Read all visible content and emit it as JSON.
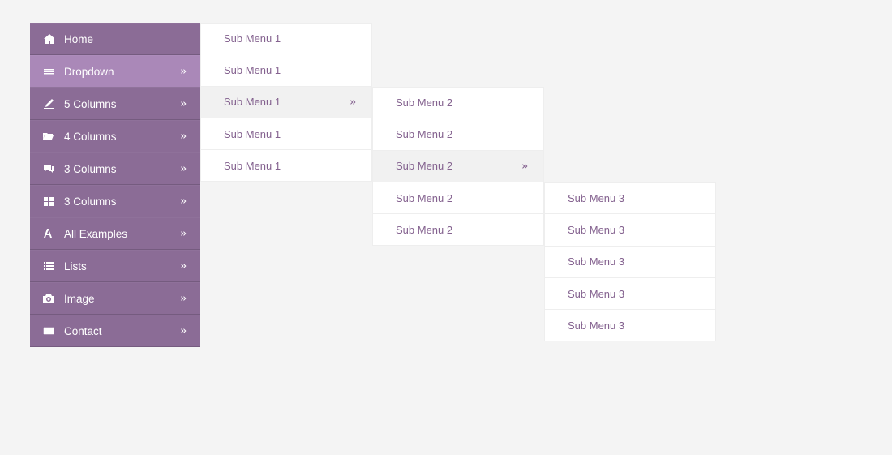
{
  "sidebar": {
    "items": [
      {
        "label": "Home",
        "icon": "home",
        "hasSubmenu": false,
        "active": false
      },
      {
        "label": "Dropdown",
        "icon": "layers",
        "hasSubmenu": true,
        "active": true
      },
      {
        "label": "5 Columns",
        "icon": "edit",
        "hasSubmenu": true,
        "active": false
      },
      {
        "label": "4 Columns",
        "icon": "folder-open",
        "hasSubmenu": true,
        "active": false
      },
      {
        "label": "3 Columns",
        "icon": "comments",
        "hasSubmenu": true,
        "active": false
      },
      {
        "label": "3 Columns",
        "icon": "grid",
        "hasSubmenu": true,
        "active": false
      },
      {
        "label": "All Examples",
        "icon": "font",
        "hasSubmenu": true,
        "active": false
      },
      {
        "label": "Lists",
        "icon": "list",
        "hasSubmenu": true,
        "active": false
      },
      {
        "label": "Image",
        "icon": "camera",
        "hasSubmenu": true,
        "active": false
      },
      {
        "label": "Contact",
        "icon": "envelope",
        "hasSubmenu": true,
        "active": false
      }
    ]
  },
  "submenu1": {
    "items": [
      {
        "label": "Sub Menu 1",
        "hasSubmenu": false,
        "hovered": false
      },
      {
        "label": "Sub Menu 1",
        "hasSubmenu": false,
        "hovered": false
      },
      {
        "label": "Sub Menu 1",
        "hasSubmenu": true,
        "hovered": true
      },
      {
        "label": "Sub Menu 1",
        "hasSubmenu": false,
        "hovered": false
      },
      {
        "label": "Sub Menu 1",
        "hasSubmenu": false,
        "hovered": false
      }
    ]
  },
  "submenu2": {
    "items": [
      {
        "label": "Sub Menu 2",
        "hasSubmenu": false,
        "hovered": false
      },
      {
        "label": "Sub Menu 2",
        "hasSubmenu": false,
        "hovered": false
      },
      {
        "label": "Sub Menu 2",
        "hasSubmenu": true,
        "hovered": true
      },
      {
        "label": "Sub Menu 2",
        "hasSubmenu": false,
        "hovered": false
      },
      {
        "label": "Sub Menu 2",
        "hasSubmenu": false,
        "hovered": false
      }
    ]
  },
  "submenu3": {
    "items": [
      {
        "label": "Sub Menu 3"
      },
      {
        "label": "Sub Menu 3"
      },
      {
        "label": "Sub Menu 3"
      },
      {
        "label": "Sub Menu 3"
      },
      {
        "label": "Sub Menu 3"
      }
    ]
  }
}
